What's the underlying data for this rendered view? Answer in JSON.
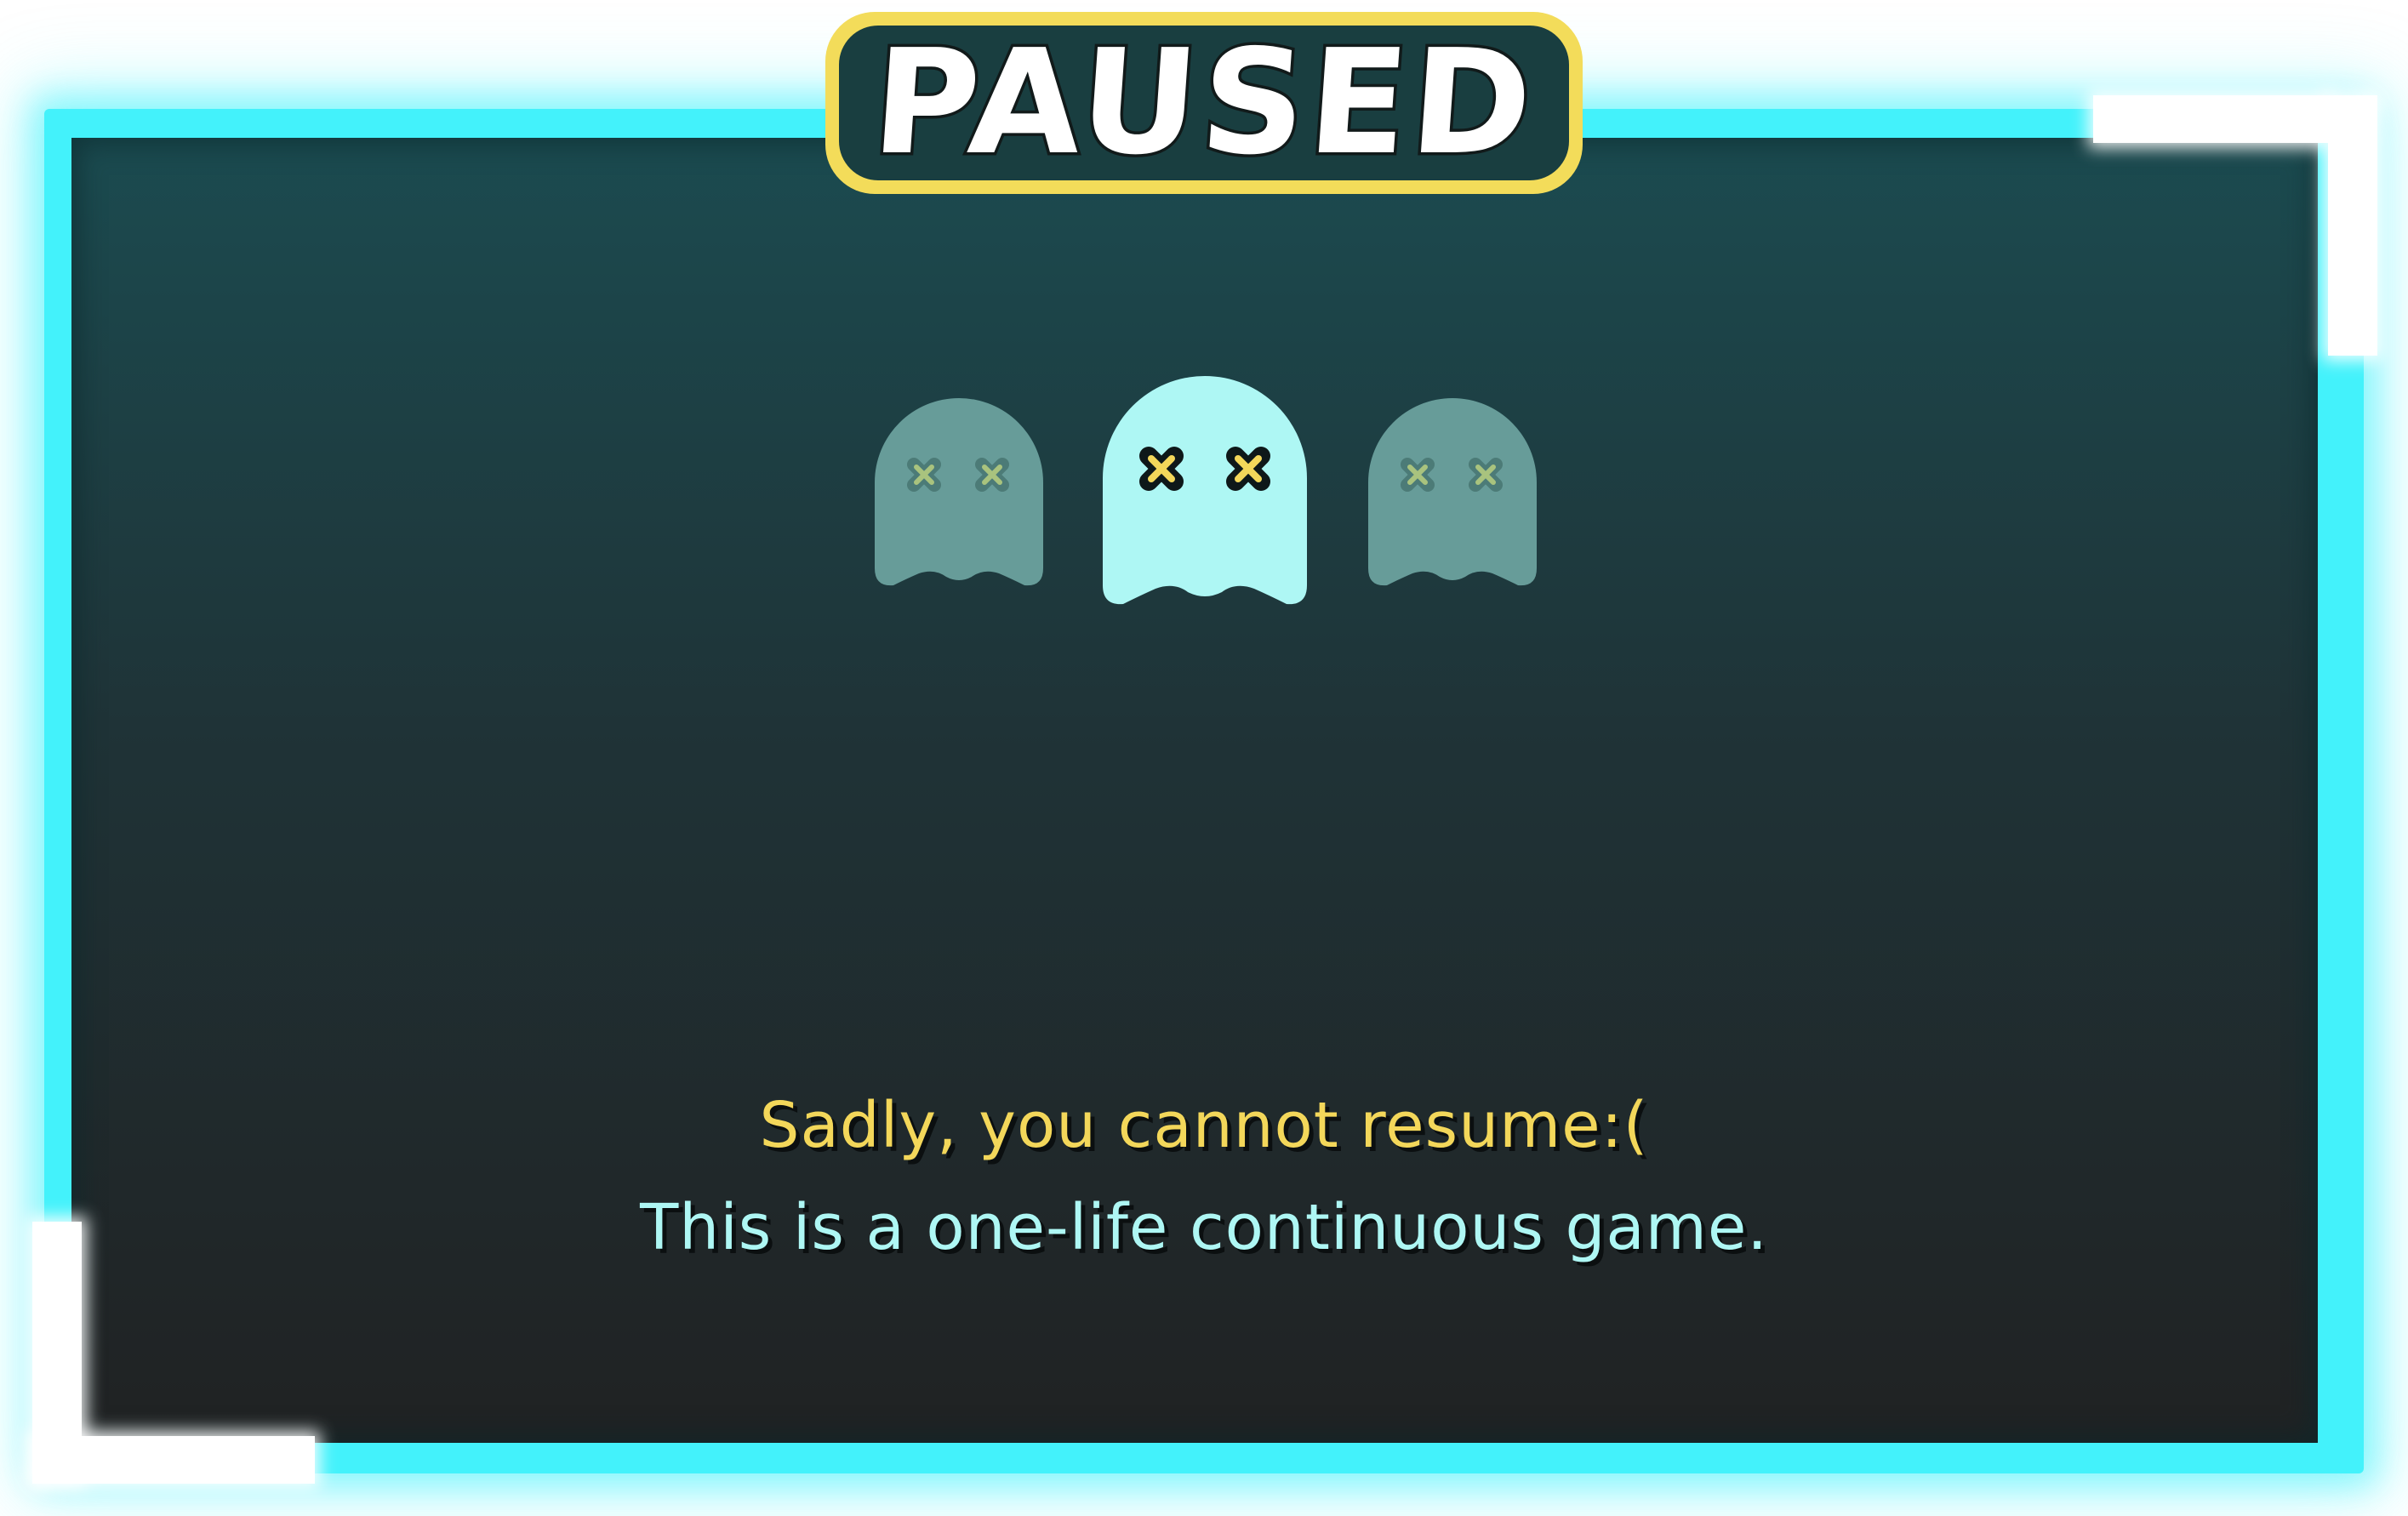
{
  "title": "PAUSED",
  "lives": {
    "total": 3,
    "active_index": 1,
    "ghost_state": "dead",
    "colors": {
      "active": "#aef7f4",
      "inactive": "#679c99",
      "eye_x": "#f3d75a"
    }
  },
  "messages": {
    "line1": "Sadly, you cannot resume:(",
    "line2": "This is a one-life continuous game."
  },
  "colors": {
    "frame": "#43f2fb",
    "title_badge": "#f3dc5a",
    "panel_top": "#1b4b50",
    "panel_bottom": "#202223"
  }
}
